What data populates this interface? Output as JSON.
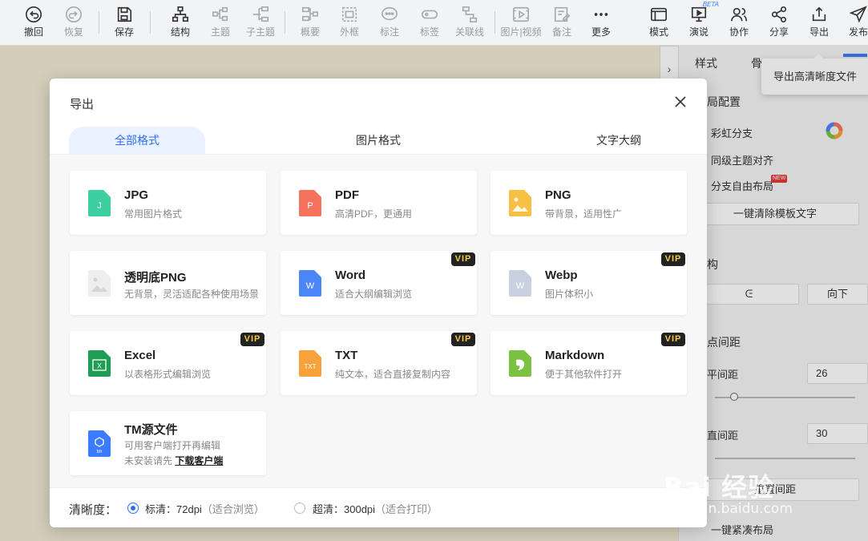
{
  "toolbar": {
    "undo": "撤回",
    "redo": "恢复",
    "save": "保存",
    "structure": "结构",
    "topic": "主题",
    "subtopic": "子主题",
    "summary": "概要",
    "boundary": "外框",
    "note_mark": "标注",
    "label": "标签",
    "relation": "关联线",
    "image_video": "图片|视频",
    "remark": "备注",
    "more": "更多",
    "mode": "模式",
    "present": "演说",
    "collab": "协作",
    "share": "分享",
    "export": "导出",
    "publish": "发布",
    "beta": "BETA"
  },
  "tooltip": "导出高清晰度文件",
  "right_panel": {
    "tab_style": "样式",
    "tab_skeleton": "骨",
    "layout_config": "局配置",
    "rainbow_branch": "彩虹分支",
    "same_level_align": "同级主题对齐",
    "branch_free_layout": "分支自由布局",
    "new_badge": "NEW",
    "clear_template_text": "一键清除模板文字",
    "structure": "构",
    "direction": "向下",
    "node_spacing": "点间距",
    "h_spacing": "平间距",
    "h_value": "26",
    "v_spacing": "直间距",
    "v_value": "30",
    "reset": "重置间距",
    "compact": "一键紧凑布局"
  },
  "dialog": {
    "title": "导出",
    "tabs": [
      "全部格式",
      "图片格式",
      "文字大纲"
    ],
    "active_tab": 0,
    "formats": [
      {
        "name": "JPG",
        "desc": "常用图片格式",
        "vip": false,
        "icon": "jpg-file-icon",
        "color": "#3ecfa1",
        "letter": "J"
      },
      {
        "name": "PDF",
        "desc": "高清PDF，更通用",
        "vip": false,
        "icon": "pdf-file-icon",
        "color": "#f5735c",
        "letter": "P"
      },
      {
        "name": "PNG",
        "desc": "带背景，适用性广",
        "vip": false,
        "icon": "png-file-icon",
        "color": "#f7c043",
        "letter": ""
      },
      {
        "name": "透明底PNG",
        "desc": "无背景，灵活适配各种使用场景",
        "vip": false,
        "icon": "transparent-png-file-icon",
        "color": "#e6e6e6",
        "letter": ""
      },
      {
        "name": "Word",
        "desc": "适合大纲编辑浏览",
        "vip": true,
        "icon": "word-file-icon",
        "color": "#4a86f7",
        "letter": "W"
      },
      {
        "name": "Webp",
        "desc": "图片体积小",
        "vip": true,
        "icon": "webp-file-icon",
        "color": "#c9d1e0",
        "letter": "W"
      },
      {
        "name": "Excel",
        "desc": "以表格形式编辑浏览",
        "vip": true,
        "icon": "excel-file-icon",
        "color": "#1f9d55",
        "letter": "X"
      },
      {
        "name": "TXT",
        "desc": "纯文本，适合直接复制内容",
        "vip": true,
        "icon": "txt-file-icon",
        "color": "#f7a23b",
        "letter": "TXT"
      },
      {
        "name": "Markdown",
        "desc": "便于其他软件打开",
        "vip": true,
        "icon": "markdown-file-icon",
        "color": "#7cc242",
        "letter": ""
      },
      {
        "name": "TM源文件",
        "desc": "可用客户端打开再编辑",
        "desc2": "未安装请先",
        "link": "下载客户端",
        "vip": false,
        "icon": "tm-file-icon",
        "color": "#3b7cff",
        "letter": "tm"
      }
    ],
    "vip_label": "VIP",
    "footer": {
      "label": "清晰度：",
      "standard": "标清：72dpi",
      "standard_hint": "（适合浏览）",
      "ultra": "超清：300dpi",
      "ultra_hint": "（适合打印）"
    }
  },
  "watermark": {
    "main": "Bai 经验",
    "sub": "jingyan.baidu.com"
  }
}
